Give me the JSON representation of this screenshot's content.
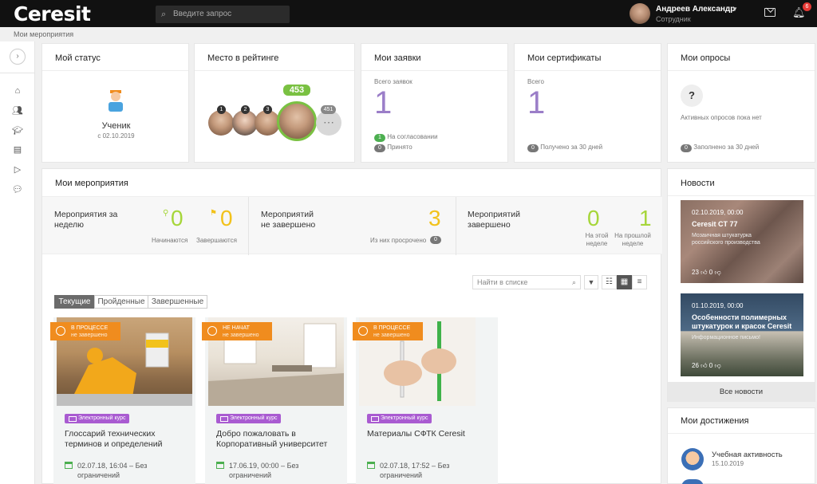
{
  "header": {
    "logo": "Ceresit",
    "search_placeholder": "Введите запрос",
    "user_name": "Андреев Александр",
    "user_role": "Сотрудник",
    "notifications_count": "6"
  },
  "breadcrumb": "Мои мероприятия",
  "status_card": {
    "title": "Мой статус",
    "level": "Ученик",
    "since": "с 02.10.2019"
  },
  "rating_card": {
    "title": "Место в рейтинге",
    "my_place": "453",
    "others_more": "451",
    "ranks": [
      "1",
      "2",
      "3"
    ]
  },
  "requests_card": {
    "title": "Мои заявки",
    "total_label": "Всего заявок",
    "total": "1",
    "pending_count": "1",
    "pending_label": "На согласовании",
    "accepted_count": "0",
    "accepted_label": "Принято"
  },
  "certs_card": {
    "title": "Мои сертификаты",
    "total_label": "Всего",
    "total": "1",
    "recent_count": "0",
    "recent_label": "Получено за 30 дней"
  },
  "surveys_card": {
    "title": "Мои опросы",
    "empty": "Активных опросов пока нет",
    "recent_count": "0",
    "recent_label": "Заполнено за 30 дней"
  },
  "events": {
    "title": "Мои мероприятия",
    "week_label": "Мероприятия за неделю",
    "starting_value": "0",
    "starting_label": "Начинаются",
    "ending_value": "0",
    "ending_label": "Завершаются",
    "unfinished_label": "Мероприятий не завершено",
    "unfinished_value": "3",
    "overdue_label": "Из них просрочено",
    "overdue_value": "0",
    "completed_label": "Мероприятий завершено",
    "this_week_value": "0",
    "this_week_label": "На этой неделе",
    "last_week_value": "1",
    "last_week_label": "На прошлой неделе",
    "list_search_placeholder": "Найти в списке",
    "tabs": [
      "Текущие",
      "Пройденные",
      "Завершенные"
    ],
    "courses": [
      {
        "status": "В ПРОЦЕССЕ",
        "substatus": "не завершено",
        "tag": "Электронный курс",
        "title": "Глоссарий технических терминов и определений",
        "date": "02.07.18, 16:04 – Без ограничений"
      },
      {
        "status": "НЕ НАЧАТ",
        "substatus": "не завершено",
        "tag": "Электронный курс",
        "title": "Добро пожаловать в Корпоративный университет",
        "date": "17.06.19, 00:00 – Без ограничений"
      },
      {
        "status": "В ПРОЦЕССЕ",
        "substatus": "не завершено",
        "tag": "Электронный курс",
        "title": "Материалы СФТК Ceresit",
        "date": "02.07.18, 17:52 – Без ограничений"
      }
    ],
    "status_color": "#f08c1e",
    "tag_color": "#a95bd1"
  },
  "news": {
    "title": "Новости",
    "items": [
      {
        "date": "02.10.2019, 00:00",
        "title": "Ceresit CT 77",
        "sub": "Мозаичная штукатурка российского производства",
        "likes": "23",
        "dislikes": "0"
      },
      {
        "date": "01.10.2019, 00:00",
        "title": "Особенности полимерных штукатурок и красок Ceresit",
        "sub": "Информационное письмо!",
        "likes": "26",
        "dislikes": "0"
      }
    ],
    "all_link": "Все новости"
  },
  "achievements": {
    "title": "Мои достижения",
    "item_title": "Учебная активность",
    "item_date": "15.10.2019"
  },
  "colors": {
    "accent_green": "#4caf50",
    "purple": "#9b7ec8",
    "yellow": "#f2c21b",
    "lime": "#a6d63a"
  }
}
